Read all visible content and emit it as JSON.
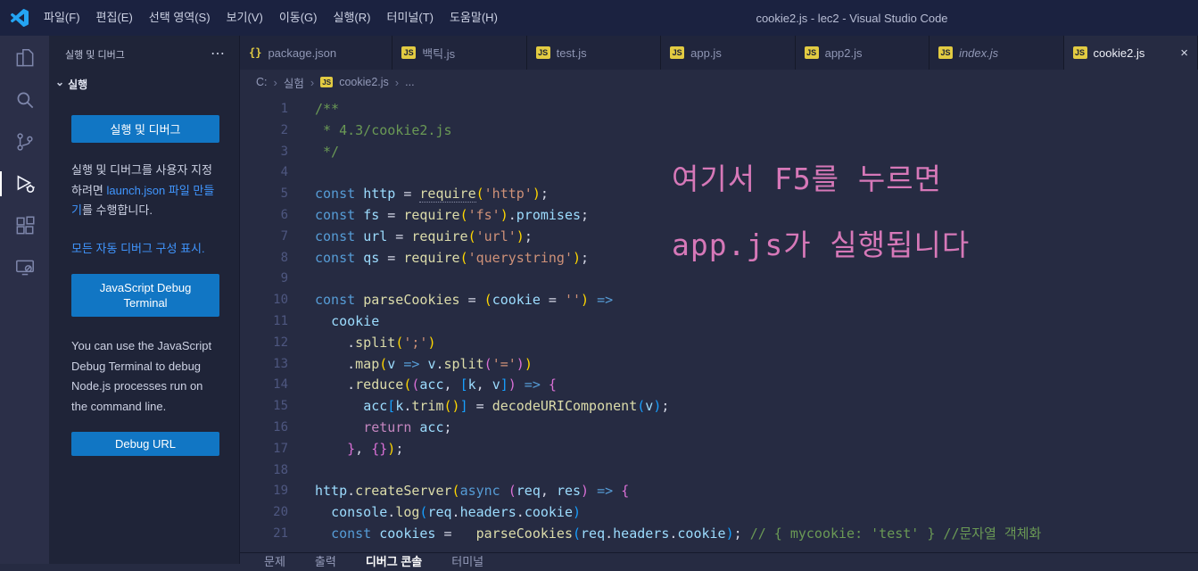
{
  "title_bar": {
    "title": "cookie2.js - lec2 - Visual Studio Code",
    "menus": [
      "파일(F)",
      "편집(E)",
      "선택 영역(S)",
      "보기(V)",
      "이동(G)",
      "실행(R)",
      "터미널(T)",
      "도움말(H)"
    ]
  },
  "activity_bar": {
    "items": [
      {
        "name": "explorer",
        "active": false
      },
      {
        "name": "search",
        "active": false
      },
      {
        "name": "source-control",
        "active": false
      },
      {
        "name": "run-and-debug",
        "active": true
      },
      {
        "name": "extensions",
        "active": false
      },
      {
        "name": "remote-explorer",
        "active": false
      }
    ]
  },
  "sidebar": {
    "title": "실행 및 디버그",
    "more_actions": "⋯",
    "section_chevron": "⌄",
    "section_label": "실행",
    "run_debug_button": "실행 및 디버그",
    "customize_text_1": "실행 및 디버그를 사용자 지정하려면 ",
    "customize_link": "launch.json 파일 만들기",
    "customize_text_2": "를 수행합니다.",
    "show_configs_link": "모든 자동 디버그 구성 표시.",
    "js_debug_terminal_button": "JavaScript Debug Terminal",
    "terminal_info_text": "You can use the JavaScript Debug Terminal to debug Node.js processes run on the command line.",
    "debug_url_button": "Debug URL"
  },
  "editor": {
    "tabs": [
      {
        "label": "package.json",
        "icon": "json",
        "active": false,
        "italic": false
      },
      {
        "label": "백틱.js",
        "icon": "js",
        "active": false,
        "italic": false
      },
      {
        "label": "test.js",
        "icon": "js",
        "active": false,
        "italic": false
      },
      {
        "label": "app.js",
        "icon": "js",
        "active": false,
        "italic": false
      },
      {
        "label": "app2.js",
        "icon": "js",
        "active": false,
        "italic": false
      },
      {
        "label": "index.js",
        "icon": "js",
        "active": false,
        "italic": true
      },
      {
        "label": "cookie2.js",
        "icon": "js",
        "active": true,
        "italic": false,
        "close": "×"
      }
    ],
    "breadcrumb": {
      "separator": "›",
      "items": [
        {
          "label": "C:"
        },
        {
          "label": "실험"
        },
        {
          "label": "cookie2.js",
          "icon": "js"
        },
        {
          "label": "..."
        }
      ]
    },
    "lines": [
      {
        "n": 1,
        "t": [
          [
            "c",
            "/**"
          ]
        ]
      },
      {
        "n": 2,
        "t": [
          [
            "c",
            " * 4.3/cookie2.js"
          ]
        ]
      },
      {
        "n": 3,
        "t": [
          [
            "c",
            " */"
          ]
        ]
      },
      {
        "n": 4,
        "t": []
      },
      {
        "n": 5,
        "t": [
          [
            "k",
            "const"
          ],
          [
            "d",
            " "
          ],
          [
            "v",
            "http"
          ],
          [
            "d",
            " = "
          ],
          [
            "f sq",
            "require"
          ],
          [
            "b1",
            "("
          ],
          [
            "s",
            "'http'"
          ],
          [
            "b1",
            ")"
          ],
          [
            "d",
            ";"
          ]
        ]
      },
      {
        "n": 6,
        "t": [
          [
            "k",
            "const"
          ],
          [
            "d",
            " "
          ],
          [
            "v",
            "fs"
          ],
          [
            "d",
            " = "
          ],
          [
            "f",
            "require"
          ],
          [
            "b1",
            "("
          ],
          [
            "s",
            "'fs'"
          ],
          [
            "b1",
            ")"
          ],
          [
            "d",
            "."
          ],
          [
            "v",
            "promises"
          ],
          [
            "d",
            ";"
          ]
        ]
      },
      {
        "n": 7,
        "t": [
          [
            "k",
            "const"
          ],
          [
            "d",
            " "
          ],
          [
            "v",
            "url"
          ],
          [
            "d",
            " = "
          ],
          [
            "f",
            "require"
          ],
          [
            "b1",
            "("
          ],
          [
            "s",
            "'url'"
          ],
          [
            "b1",
            ")"
          ],
          [
            "d",
            ";"
          ]
        ]
      },
      {
        "n": 8,
        "t": [
          [
            "k",
            "const"
          ],
          [
            "d",
            " "
          ],
          [
            "v",
            "qs"
          ],
          [
            "d",
            " = "
          ],
          [
            "f",
            "require"
          ],
          [
            "b1",
            "("
          ],
          [
            "s",
            "'querystring'"
          ],
          [
            "b1",
            ")"
          ],
          [
            "d",
            ";"
          ]
        ]
      },
      {
        "n": 9,
        "t": []
      },
      {
        "n": 10,
        "t": [
          [
            "k",
            "const"
          ],
          [
            "d",
            " "
          ],
          [
            "f",
            "parseCookies"
          ],
          [
            "d",
            " = "
          ],
          [
            "b1",
            "("
          ],
          [
            "v",
            "cookie"
          ],
          [
            "d",
            " = "
          ],
          [
            "s",
            "''"
          ],
          [
            "b1",
            ")"
          ],
          [
            "a",
            " =>"
          ]
        ]
      },
      {
        "n": 11,
        "t": [
          [
            "d",
            "  "
          ],
          [
            "v",
            "cookie"
          ]
        ]
      },
      {
        "n": 12,
        "t": [
          [
            "d",
            "    ."
          ],
          [
            "f",
            "split"
          ],
          [
            "b1",
            "("
          ],
          [
            "s",
            "';'"
          ],
          [
            "b1",
            ")"
          ]
        ]
      },
      {
        "n": 13,
        "t": [
          [
            "d",
            "    ."
          ],
          [
            "f",
            "map"
          ],
          [
            "b1",
            "("
          ],
          [
            "v",
            "v"
          ],
          [
            "a",
            " => "
          ],
          [
            "v",
            "v"
          ],
          [
            "d",
            "."
          ],
          [
            "f",
            "split"
          ],
          [
            "b2",
            "("
          ],
          [
            "s",
            "'='"
          ],
          [
            "b2",
            ")"
          ],
          [
            "b1",
            ")"
          ]
        ]
      },
      {
        "n": 14,
        "t": [
          [
            "d",
            "    ."
          ],
          [
            "f",
            "reduce"
          ],
          [
            "b1",
            "("
          ],
          [
            "b2",
            "("
          ],
          [
            "v",
            "acc"
          ],
          [
            "d",
            ", "
          ],
          [
            "b3",
            "["
          ],
          [
            "v",
            "k"
          ],
          [
            "d",
            ", "
          ],
          [
            "v",
            "v"
          ],
          [
            "b3",
            "]"
          ],
          [
            "b2",
            ")"
          ],
          [
            "a",
            " => "
          ],
          [
            "b2",
            "{"
          ]
        ]
      },
      {
        "n": 15,
        "t": [
          [
            "d",
            "      "
          ],
          [
            "v",
            "acc"
          ],
          [
            "b3",
            "["
          ],
          [
            "v",
            "k"
          ],
          [
            "d",
            "."
          ],
          [
            "f",
            "trim"
          ],
          [
            "b1",
            "("
          ],
          [
            "b1",
            ")"
          ],
          [
            "b3",
            "]"
          ],
          [
            "d",
            " = "
          ],
          [
            "f",
            "decodeURIComponent"
          ],
          [
            "b3",
            "("
          ],
          [
            "v",
            "v"
          ],
          [
            "b3",
            ")"
          ],
          [
            "d",
            ";"
          ]
        ]
      },
      {
        "n": 16,
        "t": [
          [
            "d",
            "      "
          ],
          [
            "kp",
            "return"
          ],
          [
            "d",
            " "
          ],
          [
            "v",
            "acc"
          ],
          [
            "d",
            ";"
          ]
        ]
      },
      {
        "n": 17,
        "t": [
          [
            "d",
            "    "
          ],
          [
            "b2",
            "}"
          ],
          [
            "d",
            ", "
          ],
          [
            "b2",
            "{}"
          ],
          [
            "b1",
            ")"
          ],
          [
            "d",
            ";"
          ]
        ]
      },
      {
        "n": 18,
        "t": []
      },
      {
        "n": 19,
        "t": [
          [
            "v",
            "http"
          ],
          [
            "d",
            "."
          ],
          [
            "f",
            "createServer"
          ],
          [
            "b1",
            "("
          ],
          [
            "k",
            "async"
          ],
          [
            "d",
            " "
          ],
          [
            "b2",
            "("
          ],
          [
            "v",
            "req"
          ],
          [
            "d",
            ", "
          ],
          [
            "v",
            "res"
          ],
          [
            "b2",
            ")"
          ],
          [
            "a",
            " => "
          ],
          [
            "b2",
            "{"
          ]
        ]
      },
      {
        "n": 20,
        "t": [
          [
            "d",
            "  "
          ],
          [
            "v",
            "console"
          ],
          [
            "d",
            "."
          ],
          [
            "f",
            "log"
          ],
          [
            "b3",
            "("
          ],
          [
            "v",
            "req"
          ],
          [
            "d",
            "."
          ],
          [
            "v",
            "headers"
          ],
          [
            "d",
            "."
          ],
          [
            "v",
            "cookie"
          ],
          [
            "b3",
            ")"
          ]
        ]
      },
      {
        "n": 21,
        "t": [
          [
            "d",
            "  "
          ],
          [
            "k",
            "const"
          ],
          [
            "d",
            " "
          ],
          [
            "v",
            "cookies"
          ],
          [
            "d",
            " =   "
          ],
          [
            "f",
            "parseCookies"
          ],
          [
            "b3",
            "("
          ],
          [
            "v",
            "req"
          ],
          [
            "d",
            "."
          ],
          [
            "v",
            "headers"
          ],
          [
            "d",
            "."
          ],
          [
            "v",
            "cookie"
          ],
          [
            "b3",
            ")"
          ],
          [
            "d",
            "; "
          ],
          [
            "c",
            "// { mycookie: 'test' } //문자열 객체화"
          ]
        ]
      }
    ]
  },
  "annotation": {
    "color": "#d678b8",
    "line1": "여기서 F5를 누르면",
    "line2": "app.js가 실행됩니다"
  },
  "panel": {
    "tabs": [
      "문제",
      "출력",
      "디버그 콘솔",
      "터미널"
    ],
    "active_tab": "디버그 콘솔"
  }
}
